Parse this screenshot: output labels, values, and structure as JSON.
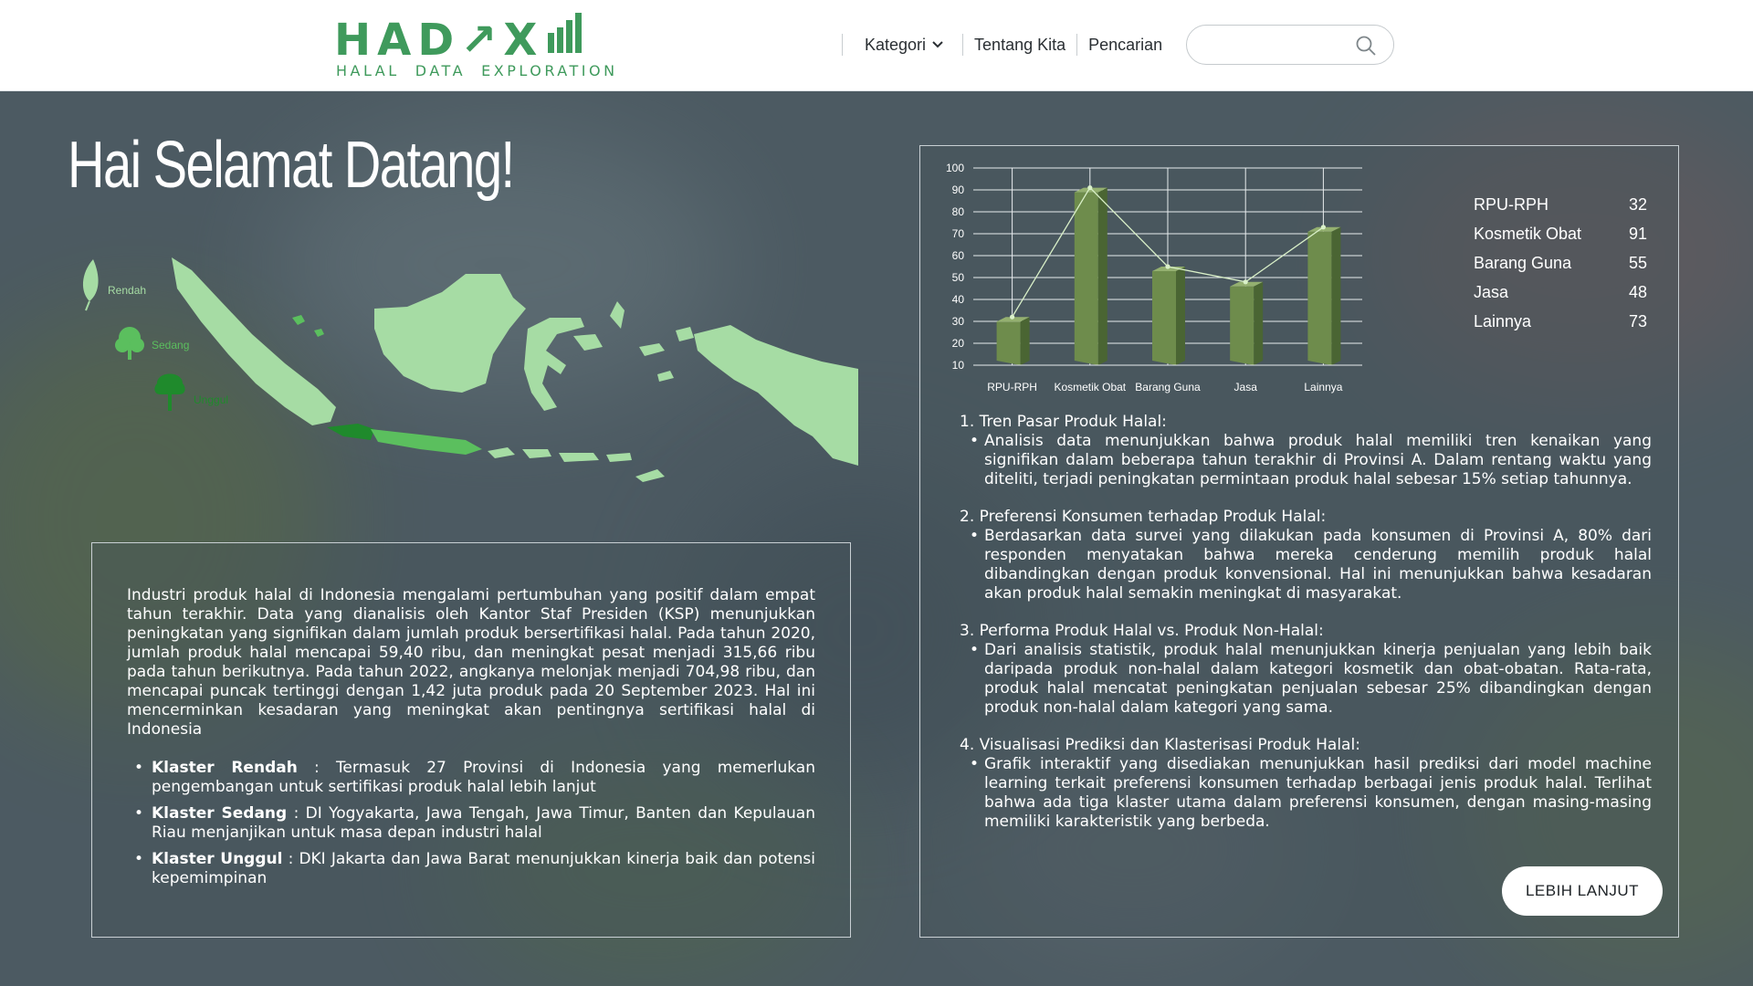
{
  "header": {
    "logo": {
      "word": "HAD↗X",
      "subtitle": "HALAL  DATA  EXPLORATION"
    },
    "nav": {
      "kategori": "Kategori",
      "tentang": "Tentang Kita",
      "pencarian": "Pencarian"
    },
    "search": {
      "placeholder": ""
    }
  },
  "welcome": {
    "title": "Hai Selamat Datang!"
  },
  "map": {
    "legend": [
      {
        "label": "Rendah",
        "color": "#a6dca4"
      },
      {
        "label": "Sedang",
        "color": "#5bbf5e"
      },
      {
        "label": "Unggul",
        "color": "#1f8a2c"
      }
    ]
  },
  "left_panel": {
    "intro": "Industri produk halal di Indonesia mengalami pertumbuhan yang positif dalam empat tahun terakhir. Data yang dianalisis oleh Kantor Staf Presiden (KSP) menunjukkan peningkatan yang signifikan dalam jumlah produk bersertifikasi halal. Pada tahun 2020, jumlah produk halal mencapai 59,40 ribu, dan meningkat pesat menjadi 315,66 ribu pada tahun berikutnya. Pada tahun 2022, angkanya melonjak menjadi 704,98 ribu, dan mencapai puncak tertinggi dengan 1,42 juta produk pada 20 September 2023. Hal ini mencerminkan kesadaran yang meningkat akan pentingnya sertifikasi halal di Indonesia",
    "clusters": [
      {
        "name": "Klaster Rendah",
        "text": " : Termasuk 27 Provinsi di Indonesia yang memerlukan pengembangan untuk sertifikasi produk halal lebih lanjut"
      },
      {
        "name": "Klaster Sedang",
        "text": " : DI Yogyakarta, Jawa Tengah, Jawa Timur, Banten dan Kepulauan Riau menjanjikan untuk masa depan industri halal"
      },
      {
        "name": "Klaster Unggul",
        "text": " : DKI Jakarta dan Jawa Barat menunjukkan kinerja baik dan potensi kepemimpinan"
      }
    ]
  },
  "chart_data": {
    "type": "bar",
    "categories": [
      "RPU-RPH",
      "Kosmetik Obat",
      "Barang Guna",
      "Jasa",
      "Lainnya"
    ],
    "values": [
      32,
      91,
      55,
      48,
      73
    ],
    "overlay_line": true,
    "yticks": [
      10,
      20,
      30,
      40,
      50,
      60,
      70,
      80,
      90,
      100
    ],
    "ylim": [
      10,
      100
    ],
    "grid": true,
    "legend_position": "right",
    "title": "",
    "xlabel": "",
    "ylabel": "",
    "colors": {
      "bar_front": "#6e8c4c",
      "bar_side": "#4a6533",
      "bar_top": "#94b070",
      "line": "#d9f0c8",
      "grid": "#e8ecee"
    }
  },
  "insights": [
    {
      "title": "1. Tren Pasar Produk Halal:",
      "body": "Analisis data menunjukkan bahwa produk halal memiliki tren kenaikan yang signifikan dalam beberapa tahun terakhir di Provinsi A. Dalam rentang waktu yang diteliti, terjadi peningkatan permintaan produk halal sebesar 15% setiap tahunnya."
    },
    {
      "title": "2. Preferensi Konsumen terhadap Produk Halal:",
      "body": "Berdasarkan data survei yang dilakukan pada konsumen di Provinsi A, 80% dari responden menyatakan bahwa mereka cenderung memilih produk halal dibandingkan dengan produk konvensional. Hal ini menunjukkan bahwa kesadaran akan produk halal semakin meningkat di masyarakat."
    },
    {
      "title": "3. Performa Produk Halal vs. Produk Non-Halal:",
      "body": "Dari analisis statistik, produk halal menunjukkan kinerja penjualan yang lebih baik daripada produk non-halal dalam kategori kosmetik dan obat-obatan. Rata-rata, produk halal mencatat peningkatan penjualan sebesar 25% dibandingkan dengan produk non-halal dalam kategori yang sama."
    },
    {
      "title": "4. Visualisasi Prediksi dan Klasterisasi Produk Halal:",
      "body": "Grafik interaktif yang disediakan menunjukkan hasil prediksi dari model machine learning terkait preferensi konsumen terhadap berbagai jenis produk halal. Terlihat bahwa ada tiga klaster utama dalam preferensi konsumen, dengan masing-masing memiliki karakteristik yang berbeda."
    }
  ],
  "more_button": "LEBIH LANJUT",
  "colors": {
    "brand": "#3f9a5c",
    "background": "#4c5a62",
    "map_rendah": "#a6dca4",
    "map_sedang": "#5bbf5e",
    "map_unggul": "#1f8a2c"
  }
}
